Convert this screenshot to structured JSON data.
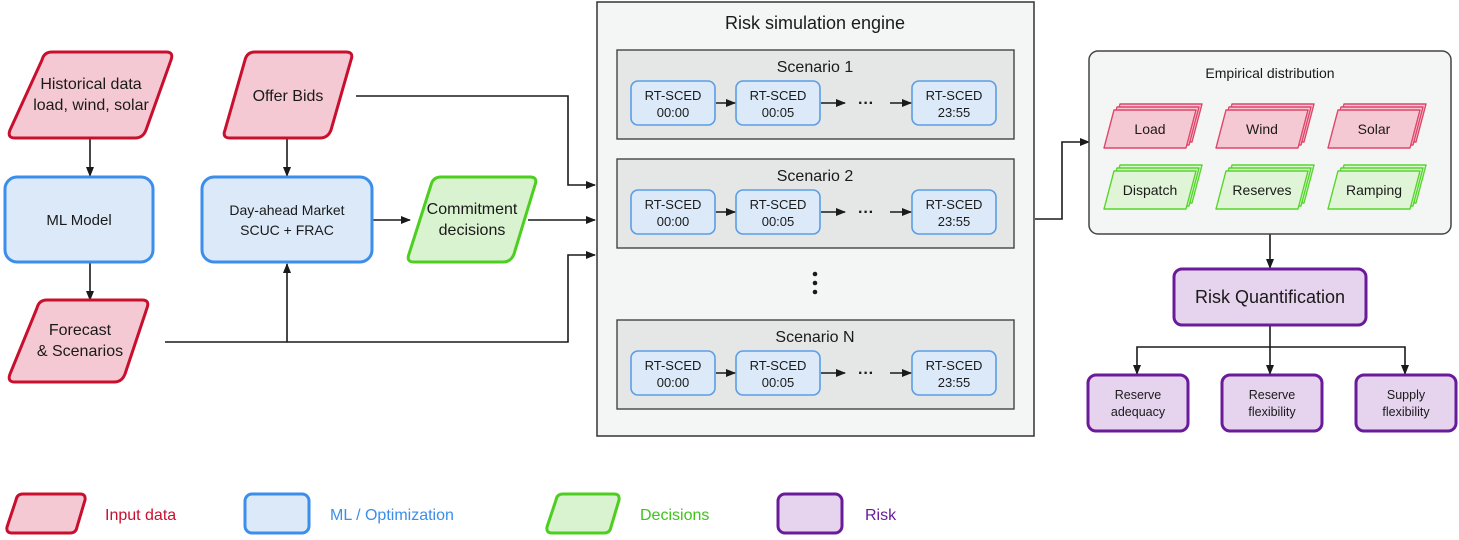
{
  "inputs": {
    "historical": [
      "Historical data",
      "load, wind, solar"
    ],
    "offer_bids": "Offer Bids",
    "forecast": [
      "Forecast",
      "& Scenarios"
    ]
  },
  "ml": {
    "ml_model": "ML Model",
    "day_ahead": [
      "Day-ahead Market",
      "SCUC + FRAC"
    ]
  },
  "decisions": {
    "commitment": [
      "Commitment",
      "decisions"
    ]
  },
  "engine": {
    "title": "Risk simulation engine",
    "scenarios": [
      {
        "title": "Scenario 1",
        "steps": [
          [
            "RT-SCED",
            "00:00"
          ],
          [
            "RT-SCED",
            "00:05"
          ],
          [
            "RT-SCED",
            "23:55"
          ]
        ]
      },
      {
        "title": "Scenario 2",
        "steps": [
          [
            "RT-SCED",
            "00:00"
          ],
          [
            "RT-SCED",
            "00:05"
          ],
          [
            "RT-SCED",
            "23:55"
          ]
        ]
      },
      {
        "title": "Scenario N",
        "steps": [
          [
            "RT-SCED",
            "00:00"
          ],
          [
            "RT-SCED",
            "00:05"
          ],
          [
            "RT-SCED",
            "23:55"
          ]
        ]
      }
    ],
    "ellipsis_h": "···",
    "ellipsis_v": "⋮"
  },
  "empirical": {
    "title": "Empirical distribution",
    "inputs": [
      "Load",
      "Wind",
      "Solar"
    ],
    "outputs": [
      "Dispatch",
      "Reserves",
      "Ramping"
    ]
  },
  "risk": {
    "title": "Risk Quantification",
    "metrics": [
      [
        "Reserve",
        "adequacy"
      ],
      [
        "Reserve",
        "flexibility"
      ],
      [
        "Supply",
        "flexibility"
      ]
    ]
  },
  "legend": [
    {
      "label": "Input data",
      "color": "#c8102e"
    },
    {
      "label": "ML / Optimization",
      "color": "#3b8eea"
    },
    {
      "label": "Decisions",
      "color": "#3fc41a"
    },
    {
      "label": "Risk",
      "color": "#6a1b9a"
    }
  ]
}
